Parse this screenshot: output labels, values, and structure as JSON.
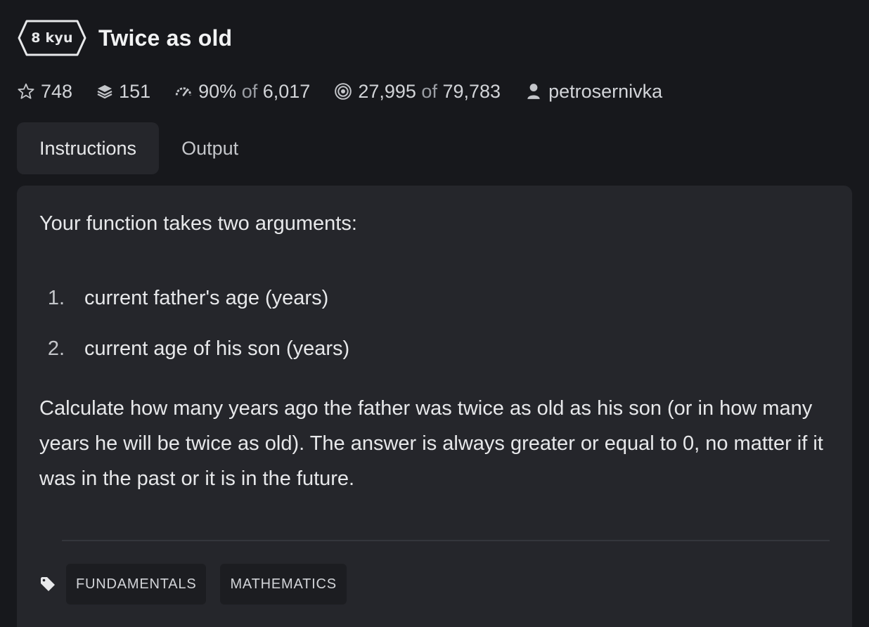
{
  "kata": {
    "rank": "8 kyu",
    "title": "Twice as old"
  },
  "stats": {
    "stars": "748",
    "collections": "151",
    "satisfaction_percent": "90%",
    "satisfaction_of": "of",
    "satisfaction_votes": "6,017",
    "completed": "27,995",
    "completed_of": "of",
    "attempts": "79,783",
    "author": "petrosernivka"
  },
  "tabs": [
    {
      "label": "Instructions",
      "active": true
    },
    {
      "label": "Output",
      "active": false
    }
  ],
  "instructions": {
    "intro": "Your function takes two arguments:",
    "list": [
      {
        "num": "1.",
        "text": "current father's age (years)"
      },
      {
        "num": "2.",
        "text": "current age of his son (years)"
      }
    ],
    "paragraph": "Calculate how many years ago the father was twice as old as his son (or in how many years he will be twice as old). The answer is always greater or equal to 0, no matter if it was in the past or it is in the future."
  },
  "tags": [
    "FUNDAMENTALS",
    "MATHEMATICS"
  ],
  "icons": {
    "rank": "hexagon-badge-icon",
    "stars": "star-outline-icon",
    "collections": "layers-icon",
    "satisfaction": "gauge-icon",
    "completed": "target-icon",
    "author": "user-icon",
    "tags": "tag-icon"
  },
  "colors": {
    "background": "#17181c",
    "panel": "#25262b",
    "text": "#e7e8ea",
    "muted": "#9b9ea4"
  }
}
